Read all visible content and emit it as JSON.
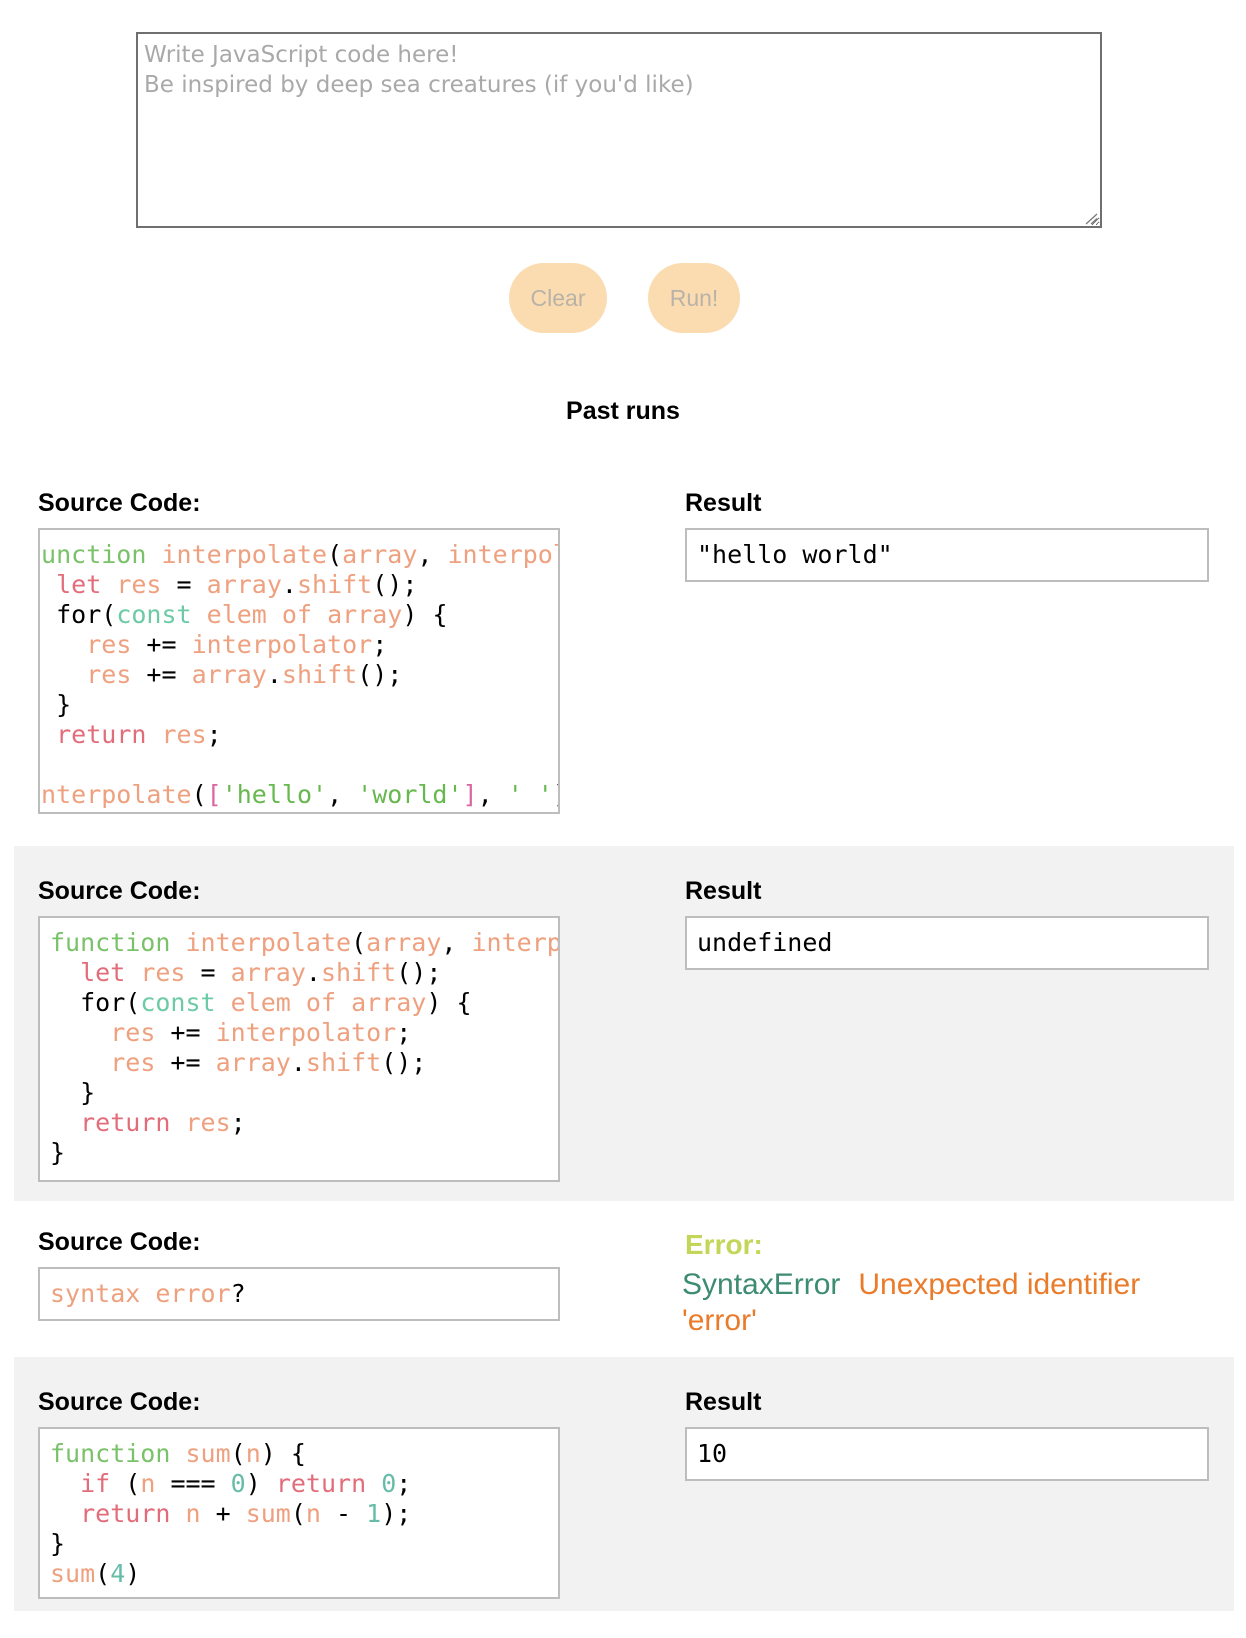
{
  "editor": {
    "placeholder": "Write JavaScript code here!\nBe inspired by deep sea creatures (if you'd like)",
    "value": ""
  },
  "buttons": {
    "clear": "Clear",
    "run": "Run!"
  },
  "past_runs_title": "Past runs",
  "labels": {
    "source_code": "Source Code:",
    "result": "Result",
    "error": "Error:"
  },
  "runs": [
    {
      "source": "function interpolate(array, interpolator) {\n  let res = array.shift();\n  for(const elem of array) {\n    res += interpolator;\n    res += array.shift();\n  }\n  return res;\n}\ninterpolate(['hello', 'world'], ' ')",
      "result": "\"hello world\""
    },
    {
      "source": "function interpolate(array, interpolator) {\n  let res = array.shift();\n  for(const elem of array) {\n    res += interpolator;\n    res += array.shift();\n  }\n  return res;\n}",
      "result": "undefined"
    },
    {
      "source": "syntax error?",
      "error_type": "SyntaxError",
      "error_message": "Unexpected identifier 'error'"
    },
    {
      "source": "function sum(n) {\n  if (n === 0) return 0;\n  return n + sum(n - 1);\n}\nsum(4)",
      "result": "10"
    }
  ],
  "colors": {
    "button_bg": "#fbdcb1",
    "shaded_row": "#f2f2f2",
    "error_label": "#c4d65a",
    "error_type": "#3c8b72",
    "error_message": "#ea7b2a"
  }
}
